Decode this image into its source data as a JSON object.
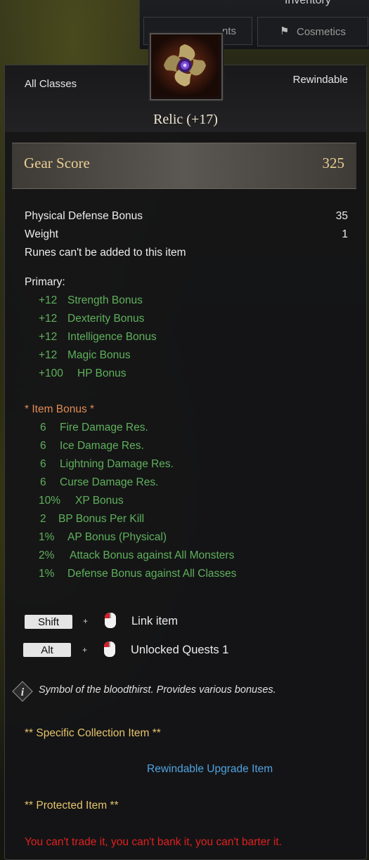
{
  "window": {
    "title": "Inventory"
  },
  "tabs": [
    {
      "label": "nts",
      "icon": "equipment-icon"
    },
    {
      "label": "Cosmetics",
      "icon": "cosmetics-icon"
    }
  ],
  "tooltip": {
    "class_restriction": "All Classes",
    "rewindable": "Rewindable",
    "item_name": "Relic (+17)",
    "item_icon": "relic-emblem-icon",
    "gear_score": {
      "label": "Gear Score",
      "value": "325"
    },
    "stats": [
      {
        "label": "Physical Defense Bonus",
        "value": "35"
      },
      {
        "label": "Weight",
        "value": "1"
      }
    ],
    "rune_note": "Runes can't be added to this item",
    "primary": {
      "label": "Primary:",
      "items": [
        {
          "amount": "+12",
          "name": "Strength Bonus"
        },
        {
          "amount": "+12",
          "name": "Dexterity Bonus"
        },
        {
          "amount": "+12",
          "name": "Intelligence Bonus"
        },
        {
          "amount": "+12",
          "name": "Magic Bonus"
        },
        {
          "amount": "+100",
          "name": "HP Bonus"
        }
      ]
    },
    "item_bonus": {
      "label": "* Item Bonus *",
      "items": [
        {
          "amount": "6",
          "name": "Fire Damage Res."
        },
        {
          "amount": "6",
          "name": "Ice Damage Res."
        },
        {
          "amount": "6",
          "name": "Lightning Damage Res."
        },
        {
          "amount": "6",
          "name": "Curse Damage Res."
        },
        {
          "amount": "10%",
          "name": "XP Bonus"
        },
        {
          "amount": "2",
          "name": "BP Bonus Per Kill"
        },
        {
          "amount": "1%",
          "name": "AP Bonus (Physical)"
        },
        {
          "amount": "2%",
          "name": "Attack Bonus against All Monsters"
        },
        {
          "amount": "1%",
          "name": "Defense Bonus against All Classes"
        }
      ]
    },
    "shortcuts": [
      {
        "key": "Shift",
        "plus": "+",
        "action": "Link item"
      },
      {
        "key": "Alt",
        "plus": "+",
        "action": "Unlocked Quests 1"
      }
    ],
    "description": "Symbol of the bloodthirst. Provides various bonuses.",
    "collection_note": "** Specific Collection Item **",
    "upgrade_link": "Rewindable Upgrade Item",
    "protected_note": "** Protected Item **",
    "trade_restriction": "You can't trade it, you can't bank it, you can't barter it."
  },
  "colors": {
    "stat_green": "#5fb15c",
    "item_bonus_orange": "#e08b55",
    "gold_text": "#e5c46b",
    "link_blue": "#4fa3e0",
    "warning_red": "#e02020"
  }
}
